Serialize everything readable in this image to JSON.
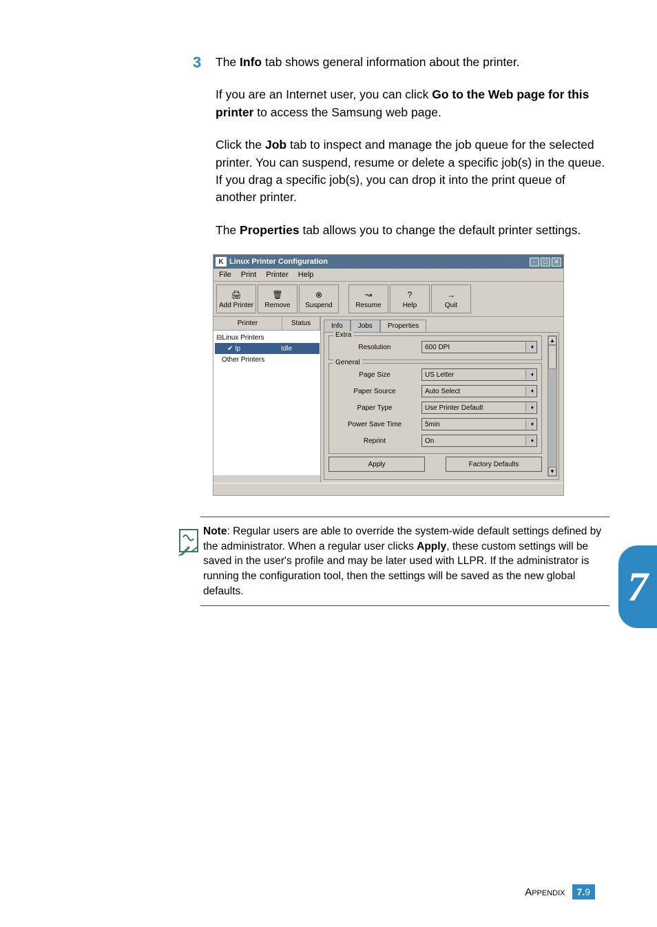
{
  "step_number": "3",
  "para1": {
    "pre": "The ",
    "bold": "Info",
    "post": " tab shows general information about the printer."
  },
  "para2": {
    "pre": "If you are an Internet user, you can click ",
    "bold": "Go to the Web page for this printer",
    "post": " to access the Samsung web page."
  },
  "para3": {
    "pre": "Click the ",
    "bold": "Job",
    "post": " tab to inspect and manage the job queue for the selected printer. You can suspend, resume or delete a specific job(s) in the queue. If you drag a specific job(s), you can drop it into the print queue of another printer."
  },
  "para4": {
    "pre": "The ",
    "bold": "Properties",
    "post": " tab allows you to change the default printer settings."
  },
  "window": {
    "title": "Linux Printer Configuration",
    "win_min": "·",
    "win_max": "□",
    "win_close": "✕",
    "menu": [
      "File",
      "Print",
      "Printer",
      "Help"
    ],
    "toolbar": [
      {
        "icon": "🖨",
        "label": "Add Printer"
      },
      {
        "icon": "🗑",
        "label": "Remove"
      },
      {
        "icon": "⊗",
        "label": "Suspend"
      },
      {
        "icon": "↝",
        "label": "Resume"
      },
      {
        "icon": "?",
        "label": "Help"
      },
      {
        "icon": "→",
        "label": "Quit"
      }
    ],
    "tree": {
      "cols": [
        "Printer",
        "Status"
      ],
      "row_root": "Linux Printers",
      "selected": {
        "name": "lp",
        "status": "Idle"
      },
      "row_other": "Other Printers"
    },
    "tabs": [
      "Info",
      "Jobs",
      "Properties"
    ],
    "extra_group": "Extra",
    "general_group": "General",
    "fields": {
      "resolution": {
        "label": "Resolution",
        "value": "600 DPI"
      },
      "page_size": {
        "label": "Page Size",
        "value": "US Letter"
      },
      "paper_source": {
        "label": "Paper Source",
        "value": "Auto Select"
      },
      "paper_type": {
        "label": "Paper Type",
        "value": "Use Printer Default"
      },
      "power_save": {
        "label": "Power Save Time",
        "value": "5min"
      },
      "reprint": {
        "label": "Reprint",
        "value": "On"
      }
    },
    "apply_btn": "Apply",
    "defaults_btn": "Factory Defaults"
  },
  "note": {
    "bold_lead": "Note",
    "text1": ": Regular users are able to override the system-wide default settings defined by the administrator. When a regular user clicks ",
    "apply": "Apply",
    "text2": ", these custom settings will be saved in the user's profile and may be later used with LLPR. If the administrator is running the configuration tool, then the settings will be saved as the new global defaults."
  },
  "side_num": "7",
  "footer": {
    "appendix": "Appendix",
    "chapter": "7.",
    "page": "9"
  }
}
